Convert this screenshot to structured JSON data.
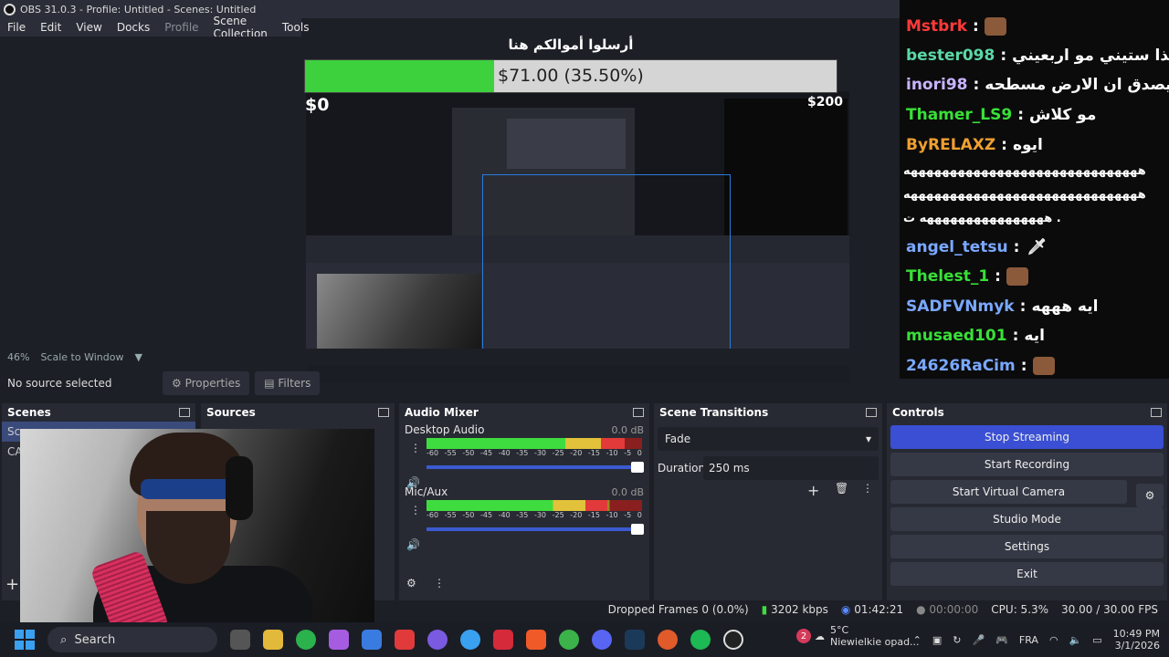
{
  "window": {
    "title": "OBS 31.0.3 - Profile: Untitled - Scenes: Untitled"
  },
  "menu": [
    "File",
    "Edit",
    "View",
    "Docks",
    "Profile",
    "Scene Collection",
    "Tools"
  ],
  "overlay": {
    "title": "أرسلوا أموالكم هنا",
    "amount_text": "$71.00 (35.50%)",
    "progress_fraction": 0.355,
    "min_label": "$0",
    "max_label": "$200"
  },
  "preview": {
    "zoom": "46%",
    "scale_mode": "Scale to Window"
  },
  "source_bar": {
    "no_source": "No source selected",
    "properties": "Properties",
    "filters": "Filters"
  },
  "chat": [
    {
      "user": "Mstbrk",
      "color": "#ff3a3a",
      "msg": ""
    },
    {
      "user": "bester098",
      "color": "#5ad8a6",
      "msg": "هذا ستيني مو اربعيني"
    },
    {
      "user": "inori98",
      "color": "#c8b4ff",
      "msg": "كلاش يصدق ان الارض مسطحه"
    },
    {
      "user": "Thamer_LS9",
      "color": "#38e038",
      "msg": "مو كلاش"
    },
    {
      "user": "ByRELAXZ",
      "color": "#f0a030",
      "msg": "ايوه"
    },
    {
      "user": "angel_tetsu",
      "color": "#7aa8ff",
      "msg": ""
    },
    {
      "user": "Thelest_1",
      "color": "#38e038",
      "msg": ""
    },
    {
      "user": "SADFVNmyk",
      "color": "#7aa8ff",
      "msg": "ايه هههه"
    },
    {
      "user": "musaed101",
      "color": "#38e038",
      "msg": "ايه"
    },
    {
      "user": "24626RaCim",
      "color": "#7aa8ff",
      "msg": ""
    }
  ],
  "chat_spam": [
    "ههههههههههههههههههههههههههههههه",
    "ههههههههههههههههههههههههههههههه",
    "ههههههههههههههههه ت ."
  ],
  "docks": {
    "scenes": {
      "title": "Scenes",
      "items": [
        "Sc",
        "CA"
      ]
    },
    "sources": {
      "title": "Sources"
    },
    "mixer": {
      "title": "Audio Mixer",
      "tracks": [
        {
          "name": "Desktop Audio",
          "db": "0.0 dB",
          "level": 0.92
        },
        {
          "name": "Mic/Aux",
          "db": "0.0 dB",
          "level": 0.84
        }
      ],
      "scale": [
        "-60",
        "-55",
        "-50",
        "-45",
        "-40",
        "-35",
        "-30",
        "-25",
        "-20",
        "-15",
        "-10",
        "-5",
        "0"
      ]
    },
    "transitions": {
      "title": "Scene Transitions",
      "selected": "Fade",
      "duration_label": "Duration",
      "duration": "250 ms"
    },
    "controls": {
      "title": "Controls",
      "buttons": [
        "Stop Streaming",
        "Start Recording",
        "Start Virtual Camera",
        "Studio Mode",
        "Settings",
        "Exit"
      ]
    }
  },
  "status": {
    "dropped": "Dropped Frames 0 (0.0%)",
    "kbps": "3202 kbps",
    "stream_time": "01:42:21",
    "rec_time": "00:00:00",
    "cpu": "CPU: 5.3%",
    "fps": "30.00 / 30.00 FPS"
  },
  "taskbar": {
    "search": "Search",
    "weather_temp": "5°C",
    "weather_text": "Niewielkie opad...",
    "weather_badge": "2",
    "lang": "FRA",
    "time": "10:49 PM",
    "date": "3/1/2026"
  }
}
